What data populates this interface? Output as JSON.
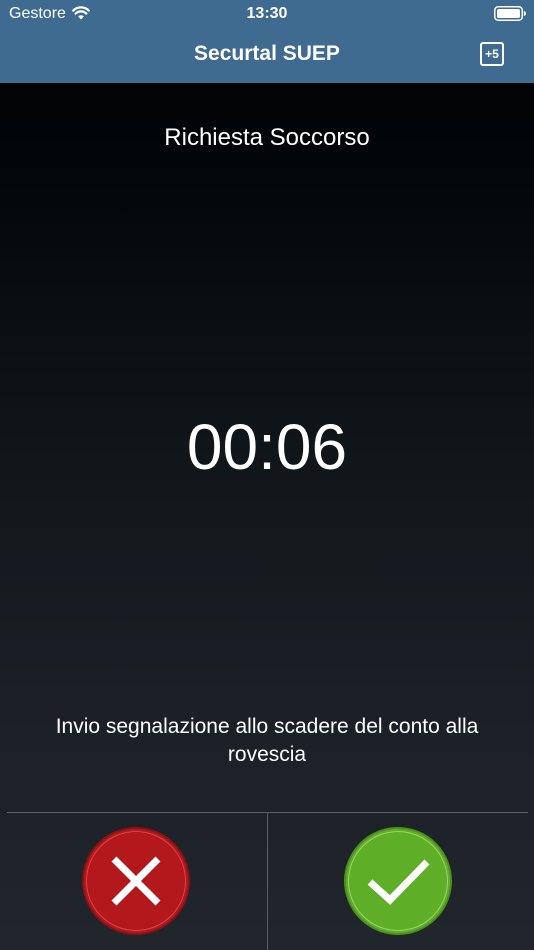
{
  "status_bar": {
    "carrier": "Gestore",
    "time": "13:30",
    "wifi_icon": "wifi-icon",
    "battery_icon": "battery-full-icon"
  },
  "nav": {
    "title": "Securtal SUEP",
    "extend_button_label": "+5"
  },
  "main": {
    "title": "Richiesta Soccorso",
    "countdown": "00:06",
    "info_text": "Invio segnalazione allo scadere del conto alla rovescia"
  },
  "actions": {
    "cancel_icon": "close-icon",
    "confirm_icon": "checkmark-icon"
  },
  "colors": {
    "header": "#3f6b91",
    "cancel": "#b3191c",
    "confirm": "#5fae27"
  }
}
